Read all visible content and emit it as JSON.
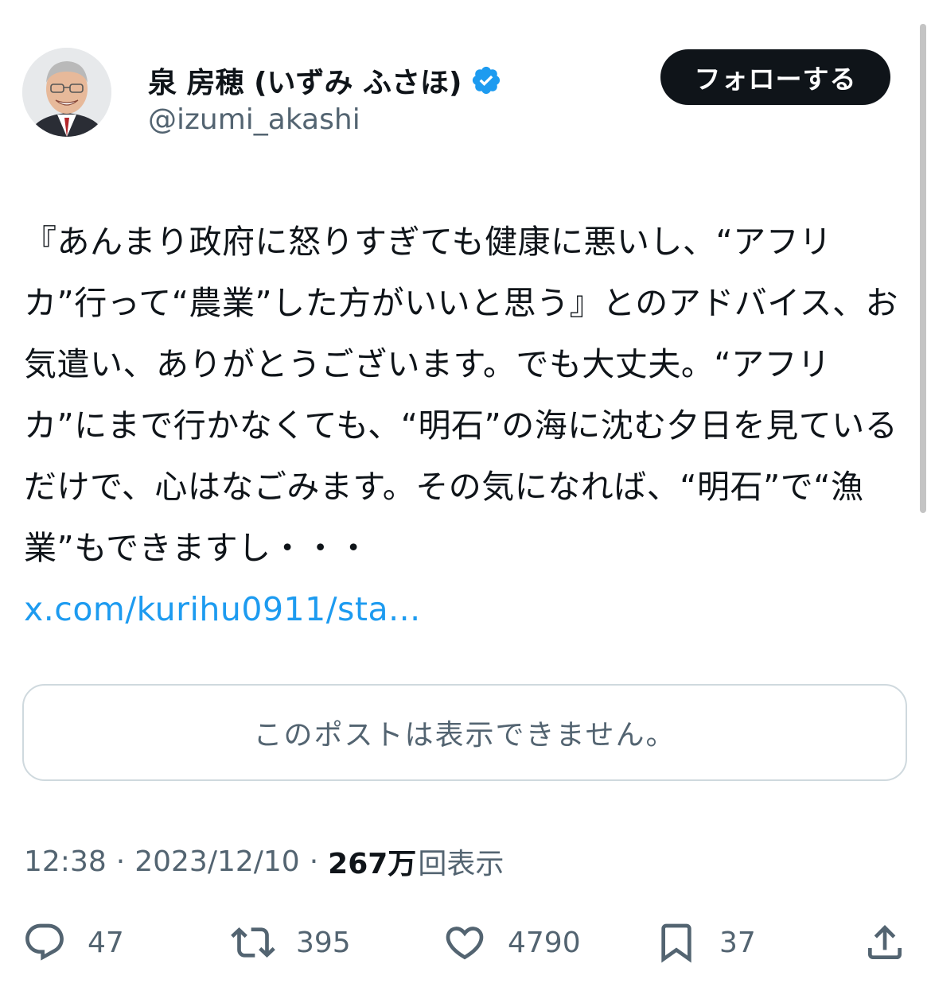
{
  "author": {
    "display_name": "泉 房穂 (いずみ ふさほ)",
    "handle": "@izumi_akashi",
    "verified": true
  },
  "follow_button": {
    "label": "フォローする"
  },
  "tweet": {
    "text": "『あんまり政府に怒りすぎても健康に悪いし、“アフリカ”行って“農業”した方がいいと思う』とのアドバイス、お気遣い、ありがとうございます。でも大丈夫。“アフリカ”にまで行かなくても、“明石”の海に沈む夕日を見ているだけで、心はなごみます。その気になれば、“明石”で“漁業”もできますし・・・",
    "link": "x.com/kurihu0911/sta..."
  },
  "quoted_post": {
    "unavailable_text": "このポストは表示できません。"
  },
  "meta": {
    "time": "12:38",
    "separator": "·",
    "date": "2023/12/10",
    "views_count": "267万",
    "views_label": "回表示"
  },
  "actions": {
    "replies": "47",
    "reposts": "395",
    "likes": "4790",
    "bookmarks": "37"
  },
  "colors": {
    "text": "#0f1419",
    "secondary": "#536471",
    "link": "#1d9bf0",
    "verified_badge": "#1d9bf0",
    "follow_button_bg": "#0f1419"
  }
}
